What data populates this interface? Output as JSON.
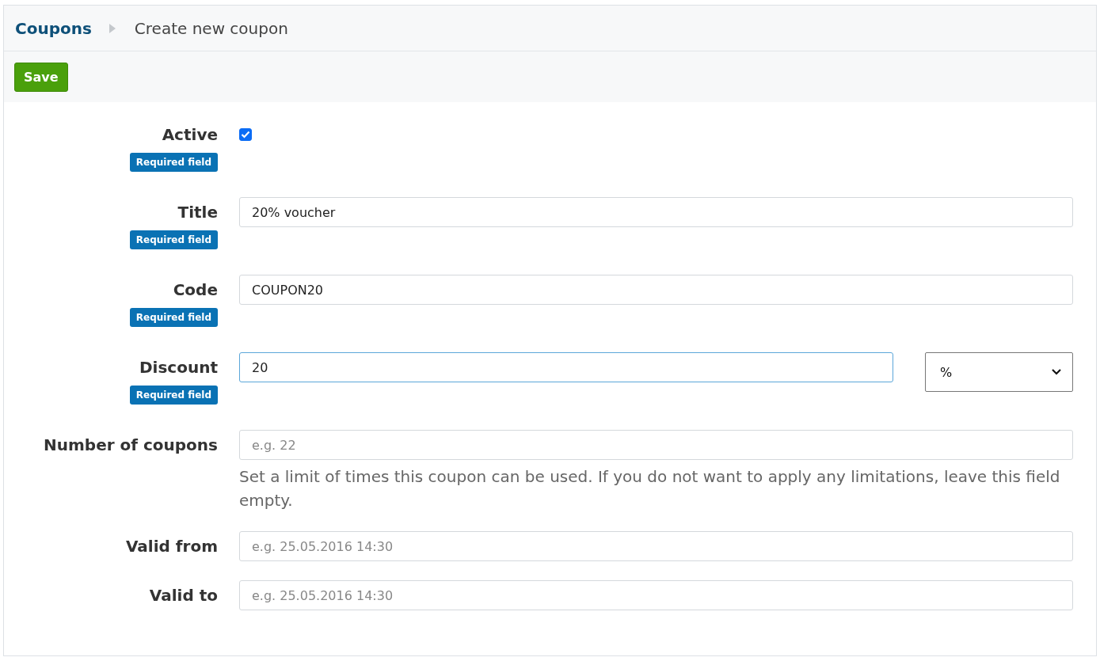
{
  "breadcrumb": {
    "parent": "Coupons",
    "current": "Create new coupon"
  },
  "toolbar": {
    "save_button": "Save"
  },
  "fields": [
    {
      "kind": "checkbox",
      "label": "Active",
      "badge": "Required field",
      "checked": true
    },
    {
      "kind": "text",
      "label": "Title",
      "badge": "Required field",
      "value": "20% voucher",
      "focused": false
    },
    {
      "kind": "text",
      "label": "Code",
      "badge": "Required field",
      "value": "COUPON20",
      "focused": false
    },
    {
      "kind": "text_select",
      "label": "Discount",
      "badge": "Required field",
      "value": "20",
      "focused": true,
      "select_value": "%"
    },
    {
      "kind": "text",
      "label": "Number of coupons",
      "placeholder": "e.g. 22",
      "help": "Set a limit of times this coupon can be used. If you do not want to apply any limitations, leave this field empty.",
      "focused": false
    },
    {
      "kind": "text",
      "label": "Valid from",
      "placeholder": "e.g. 25.05.2016 14:30",
      "focused": false
    },
    {
      "kind": "text",
      "label": "Valid to",
      "placeholder": "e.g. 25.05.2016 14:30",
      "focused": false
    }
  ]
}
